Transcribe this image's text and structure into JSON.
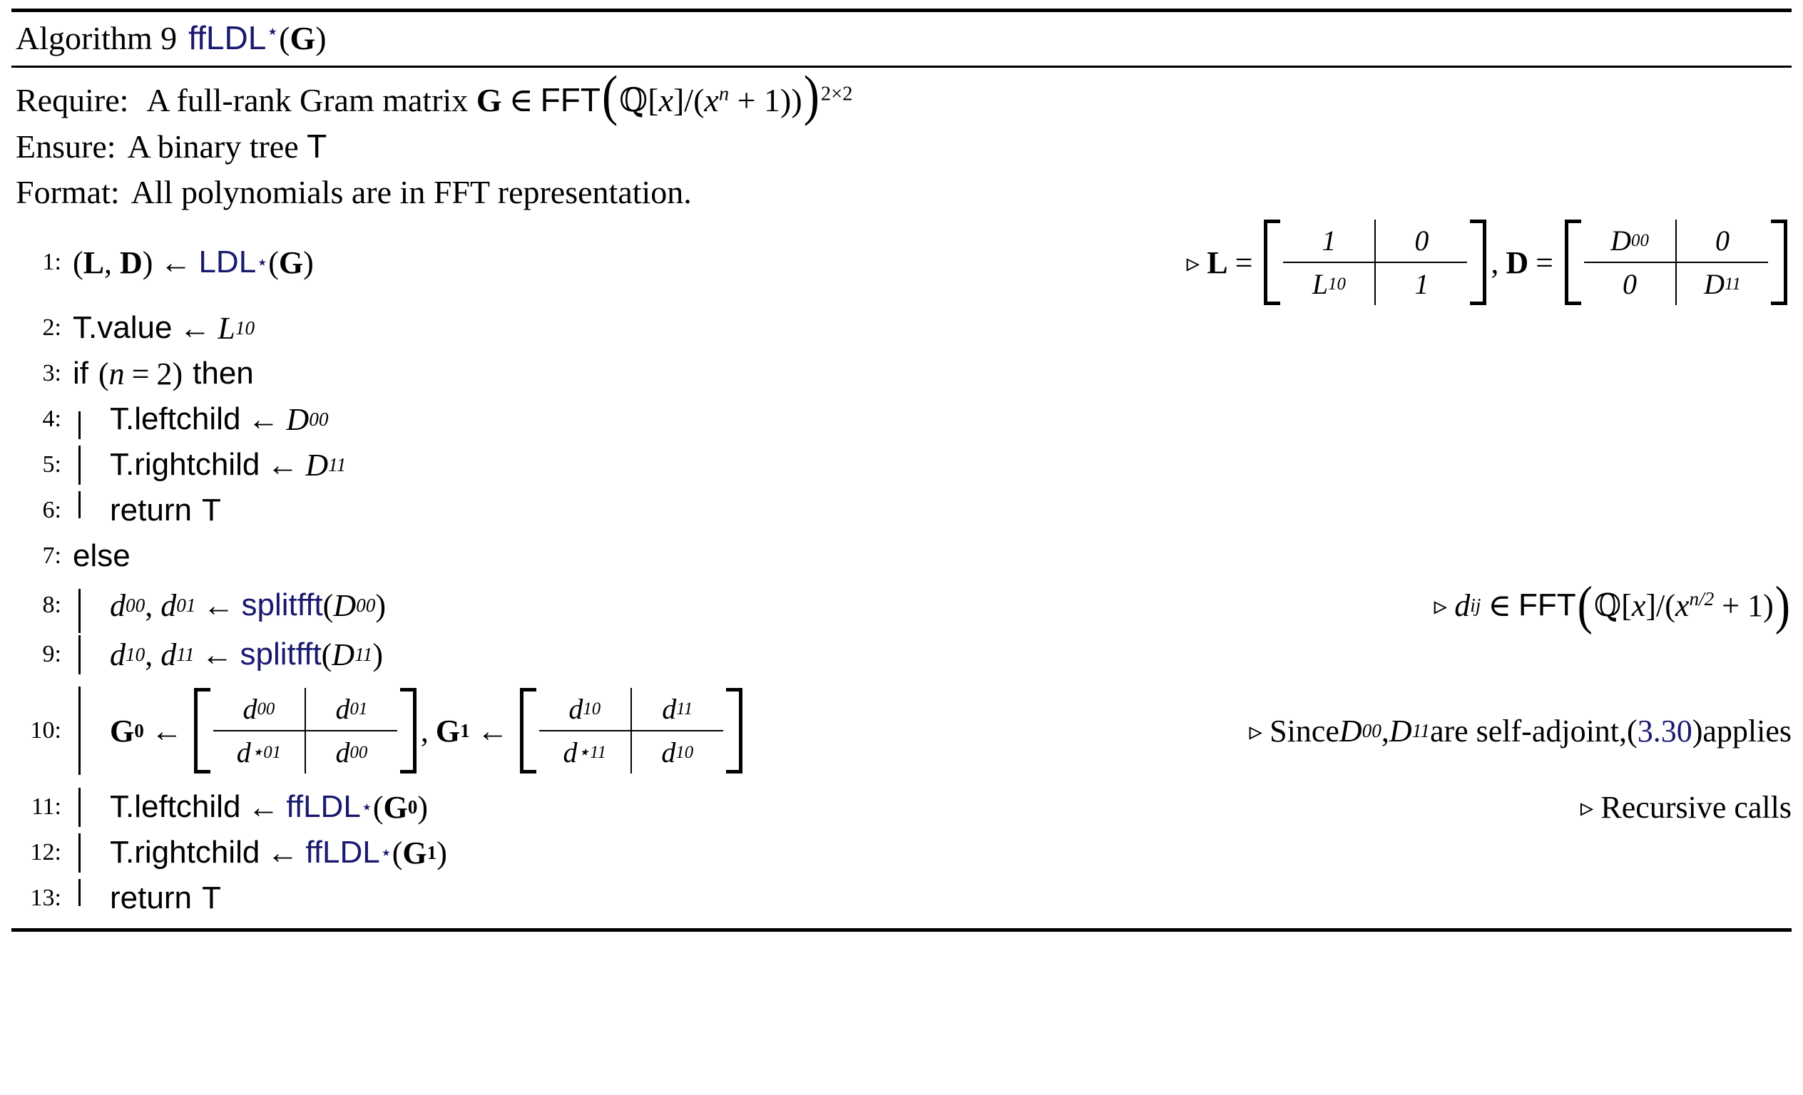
{
  "caption": {
    "label": "Algorithm 9",
    "name": "ffLDL",
    "star": "⋆",
    "arg_open": "(",
    "arg": "G",
    "arg_close": ")"
  },
  "preamble": [
    {
      "key": "Require:",
      "text_before": "A full-rank Gram matrix ",
      "symbol": "G",
      "relation": "∈",
      "set_name": "FFT",
      "set_body": "(ℚ[x]/(x",
      "set_exp": "n",
      "set_tail": " + 1))",
      "set_sup": "2×2"
    },
    {
      "key": "Ensure:",
      "text": "A binary tree T"
    },
    {
      "key": "Format:",
      "text": "All polynomials are in FFT representation."
    }
  ],
  "lines": [
    {
      "no": "1:",
      "indent": 0,
      "kind": "assign_call",
      "lhs": "(L, D)",
      "arrow": "←",
      "call": "LDL",
      "call_star": "⋆",
      "call_arg": "G",
      "comment_kind": "matrices",
      "comment": {
        "marker": "▹",
        "lhs1": "L",
        "eq": "=",
        "m1": [
          [
            "1",
            "0"
          ],
          [
            "L₁₀",
            "1"
          ]
        ],
        "m1_cells": [
          {
            "base": "1",
            "sub": ""
          },
          {
            "base": "0",
            "sub": ""
          },
          {
            "base": "L",
            "sub": "10"
          },
          {
            "base": "1",
            "sub": ""
          }
        ],
        "sep": ",",
        "lhs2": "D",
        "m2_cells": [
          {
            "base": "D",
            "sub": "00"
          },
          {
            "base": "0",
            "sub": ""
          },
          {
            "base": "0",
            "sub": ""
          },
          {
            "base": "D",
            "sub": "11"
          }
        ]
      }
    },
    {
      "no": "2:",
      "indent": 0,
      "kind": "assign",
      "lhs": "T.value",
      "arrow": "←",
      "rhs_base": "L",
      "rhs_sub": "10"
    },
    {
      "no": "3:",
      "indent": 0,
      "kind": "if",
      "if_kw": "if",
      "cond_open": "(",
      "cond_var": "n",
      "cond_eq": "=",
      "cond_val": "2",
      "cond_close": ")",
      "then_kw": "then"
    },
    {
      "no": "4:",
      "indent": 1,
      "kind": "assign",
      "lhs": "T.leftchild",
      "arrow": "←",
      "rhs_base": "D",
      "rhs_sub": "00"
    },
    {
      "no": "5:",
      "indent": 1,
      "kind": "assign",
      "lhs": "T.rightchild",
      "arrow": "←",
      "rhs_base": "D",
      "rhs_sub": "11"
    },
    {
      "no": "6:",
      "indent": 1,
      "kind": "return",
      "return_kw": "return",
      "return_val": "T"
    },
    {
      "no": "7:",
      "indent": 0,
      "kind": "else",
      "else_kw": "else"
    },
    {
      "no": "8:",
      "indent": 1,
      "kind": "split",
      "out1_base": "d",
      "out1_sub": "00",
      "out2_base": "d",
      "out2_sub": "01",
      "arrow": "←",
      "call": "splitfft",
      "call_arg_base": "D",
      "call_arg_sub": "00",
      "comment_kind": "fft",
      "comment": {
        "marker": "▹",
        "var_base": "d",
        "var_sub": "ij",
        "relation": "∈",
        "set_name": "FFT",
        "body_open": "(",
        "body": "ℚ[x]/(x",
        "exp": "n/2",
        "tail": " + 1)",
        "body_close": ")"
      }
    },
    {
      "no": "9:",
      "indent": 1,
      "kind": "split",
      "out1_base": "d",
      "out1_sub": "10",
      "out2_base": "d",
      "out2_sub": "11",
      "arrow": "←",
      "call": "splitfft",
      "call_arg_base": "D",
      "call_arg_sub": "11"
    },
    {
      "no": "10:",
      "indent": 1,
      "kind": "matrices",
      "g0_base": "G",
      "g0_sub": "0",
      "arrow": "←",
      "g0_cells": [
        {
          "base": "d",
          "sub": "00",
          "star": ""
        },
        {
          "base": "d",
          "sub": "01",
          "star": ""
        },
        {
          "base": "d",
          "sub": "01",
          "star": "⋆"
        },
        {
          "base": "d",
          "sub": "00",
          "star": ""
        }
      ],
      "sep": ",",
      "g1_base": "G",
      "g1_sub": "1",
      "g1_cells": [
        {
          "base": "d",
          "sub": "10",
          "star": ""
        },
        {
          "base": "d",
          "sub": "11",
          "star": ""
        },
        {
          "base": "d",
          "sub": "11",
          "star": "⋆"
        },
        {
          "base": "d",
          "sub": "10",
          "star": ""
        }
      ],
      "comment_kind": "selfadjoint",
      "comment": {
        "marker": "▹",
        "text_a": "Since ",
        "v1_base": "D",
        "v1_sub": "00",
        "comma": ", ",
        "v2_base": "D",
        "v2_sub": "11",
        "text_b": " are self-adjoint, ",
        "ref_open": "(",
        "ref": "3.30",
        "ref_close": ")",
        "text_c": " applies"
      }
    },
    {
      "no": "11:",
      "indent": 1,
      "kind": "assign_call",
      "lhs": "T.leftchild",
      "arrow": "←",
      "call": "ffLDL",
      "call_star": "⋆",
      "call_arg": "G",
      "call_arg_sub": "0",
      "comment_kind": "plain",
      "comment": {
        "marker": "▹",
        "text": "Recursive calls"
      }
    },
    {
      "no": "12:",
      "indent": 1,
      "kind": "assign_call",
      "lhs": "T.rightchild",
      "arrow": "←",
      "call": "ffLDL",
      "call_star": "⋆",
      "call_arg": "G",
      "call_arg_sub": "1"
    },
    {
      "no": "13:",
      "indent": 1,
      "kind": "return",
      "return_kw": "return",
      "return_val": "T"
    }
  ],
  "colors": {
    "link_blue": "#191970",
    "text_black": "#000000",
    "background": "#ffffff"
  }
}
